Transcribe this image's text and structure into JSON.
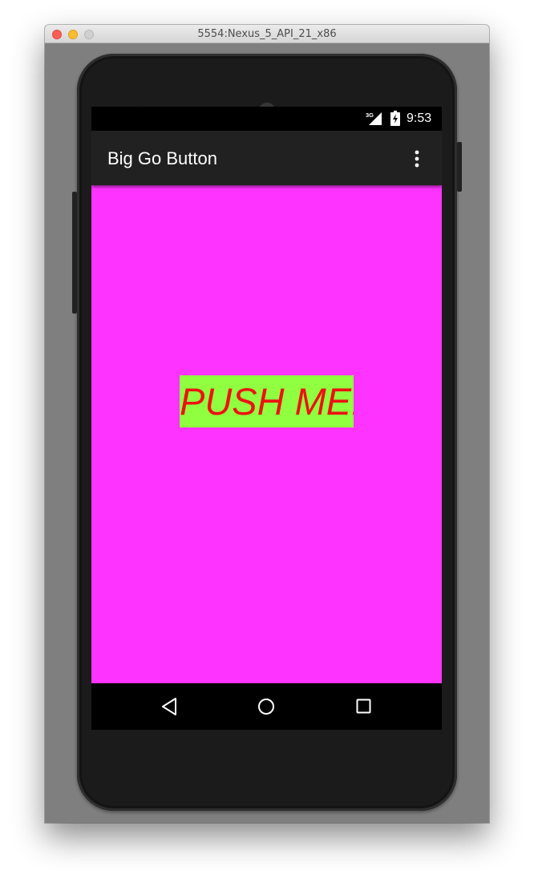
{
  "window": {
    "title": "5554:Nexus_5_API_21_x86"
  },
  "statusbar": {
    "network_label": "3G",
    "time": "9:53",
    "signal_icon": "signal-icon",
    "battery_icon": "battery-charging-icon"
  },
  "appbar": {
    "title": "Big Go Button",
    "overflow_icon": "more-vert-icon"
  },
  "main": {
    "button_label": "PUSH ME!",
    "background_color": "#ff33ff",
    "button_color": "#8fff40",
    "button_text_color": "#ee1111"
  },
  "navbar": {
    "back_icon": "back-icon",
    "home_icon": "home-icon",
    "recents_icon": "recents-icon"
  }
}
